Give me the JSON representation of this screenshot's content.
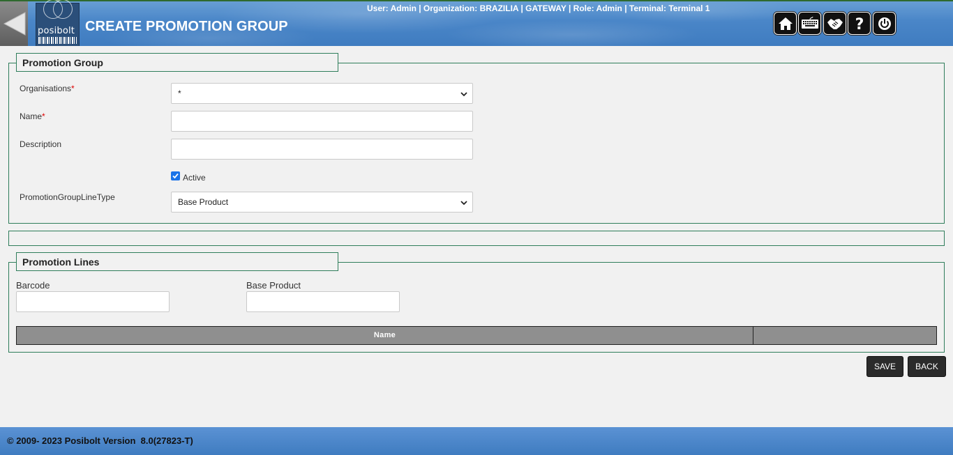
{
  "header": {
    "title": "CREATE PROMOTION GROUP",
    "user_info": "User: Admin | Organization: BRAZILIA | GATEWAY | Role: Admin | Terminal: Terminal 1",
    "logo_text": "posibolt",
    "icons": [
      "back-arrow-icon",
      "home-icon",
      "keyboard-icon",
      "handshake-icon",
      "help-icon",
      "power-icon"
    ]
  },
  "promotion_group": {
    "legend": "Promotion Group",
    "organisations": {
      "label": "Organisations",
      "required_mark": "*",
      "value": "*"
    },
    "name": {
      "label": "Name",
      "required_mark": "*",
      "value": ""
    },
    "description": {
      "label": "Description",
      "value": ""
    },
    "active": {
      "label": "Active",
      "checked": true
    },
    "line_type": {
      "label": "PromotionGroupLineType",
      "value": "Base Product"
    }
  },
  "promotion_lines": {
    "legend": "Promotion Lines",
    "barcode": {
      "label": "Barcode",
      "value": ""
    },
    "base_product": {
      "label": "Base Product",
      "value": ""
    },
    "table": {
      "columns": [
        "Name",
        ""
      ]
    }
  },
  "actions": {
    "save": "SAVE",
    "back": "BACK"
  },
  "footer": {
    "text": "© 2009- 2023 Posibolt Version  8.0(27823-T)"
  },
  "colors": {
    "header_blue": "#4a86c8",
    "panel_border": "#2e7d5a",
    "button_dark": "#2b2b2b",
    "grid_header": "#8f8f8f"
  }
}
